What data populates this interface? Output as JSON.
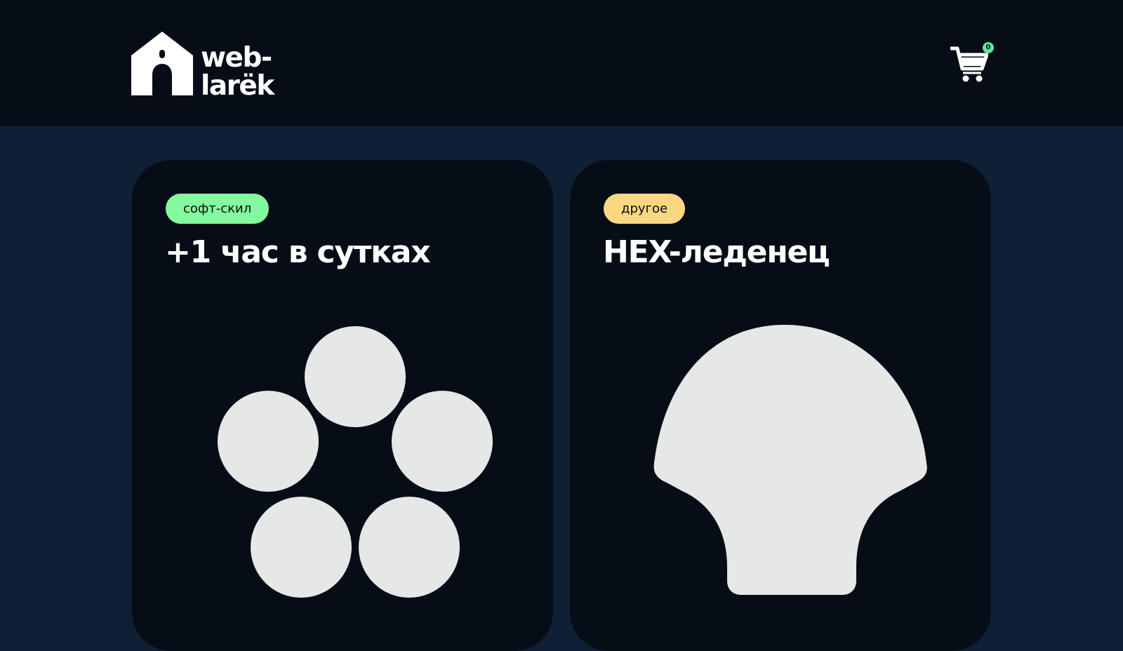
{
  "header": {
    "logo": {
      "line1": "web-",
      "line2": "larёk",
      "icon": "house-icon"
    },
    "cart": {
      "icon": "shopping-cart-icon",
      "counter": "0"
    }
  },
  "gallery": {
    "cards": [
      {
        "category": "софт-скил",
        "category_color": "#83fa9d",
        "title": "+1 час в сутках",
        "image_icon": "five-circles-icon"
      },
      {
        "category": "другое",
        "category_color": "#fad883",
        "title": "HEX-леденец",
        "image_icon": "lollipop-shell-icon"
      }
    ]
  },
  "colors": {
    "header_bg": "#070d16",
    "page_bg": "#0f1f35",
    "card_bg": "#070d16",
    "image_fill": "#e6e7e7",
    "cart_badge": "#5fe69a"
  }
}
